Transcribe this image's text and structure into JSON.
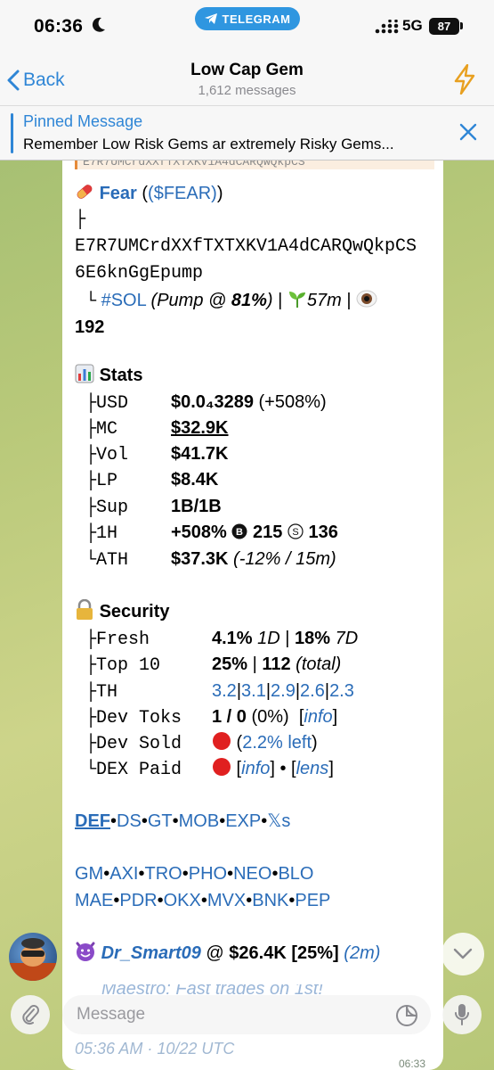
{
  "status_bar": {
    "time": "06:36",
    "app_pill": "TELEGRAM",
    "network": "5G",
    "battery": "87"
  },
  "header": {
    "back_label": "Back",
    "title": "Low Cap Gem",
    "subtitle": "1,612 messages"
  },
  "pinned": {
    "title": "Pinned Message",
    "text": "Remember Low Risk Gems ar extremely Risky Gems..."
  },
  "message": {
    "token_name": "Fear",
    "token_ticker": "($FEAR)",
    "tree_char": "├",
    "address_line1": "E7R7UMCrdXXfTXTXKV1A4dCARQwQkpCS",
    "address_line2": "6E6knGgEpump",
    "chain_tag": "#SOL",
    "pump_text": "(Pump @ ",
    "pump_pct": "81%",
    "pump_close": ")",
    "age": "57m",
    "watchers": "192",
    "stats_title": "Stats",
    "stats": [
      {
        "branch": "├",
        "label": "USD",
        "value": "$0.0₄3289",
        "extra": "(+508%)"
      },
      {
        "branch": "├",
        "label": "MC",
        "value": "$32.9K",
        "extra": ""
      },
      {
        "branch": "├",
        "label": "Vol",
        "value": "$41.7K",
        "extra": ""
      },
      {
        "branch": "├",
        "label": "LP",
        "value": "$8.4K",
        "extra": ""
      },
      {
        "branch": "├",
        "label": "Sup",
        "value": "1B/1B",
        "extra": ""
      },
      {
        "branch": "├",
        "label": "1H",
        "value": "+508%",
        "extra": "215",
        "extra2": "136"
      },
      {
        "branch": "└",
        "label": "ATH",
        "value": "$37.3K",
        "extra": "(-12% / 15m)"
      }
    ],
    "security_title": "Security",
    "security": {
      "fresh_label": "Fresh",
      "fresh_1": "4.1%",
      "fresh_1_unit": "1D",
      "fresh_2": "18%",
      "fresh_2_unit": "7D",
      "top10_label": "Top 10",
      "top10_pct": "25%",
      "top10_count": "112",
      "top10_note": "(total)",
      "th_label": "TH",
      "th_values": [
        "3.2",
        "3.1",
        "2.9",
        "2.6",
        "2.3"
      ],
      "devtoks_label": "Dev Toks",
      "devtoks_value": "1 / 0",
      "devtoks_pct": "(0%)",
      "devtoks_link": "info",
      "devsold_label": "Dev Sold",
      "devsold_value": "2.2% left",
      "dexpaid_label": "DEX Paid",
      "dexpaid_link1": "info",
      "dexpaid_link2": "lens"
    },
    "links_row1": [
      "DEF",
      "DS",
      "GT",
      "MOB",
      "EXP",
      "𝕏s"
    ],
    "links_row2": [
      "GM",
      "AXI",
      "TRO",
      "PHO",
      "NEO",
      "BLO"
    ],
    "links_row3": [
      "MAE",
      "PDR",
      "OKX",
      "MVX",
      "BNK",
      "PEP"
    ],
    "caller_name": "Dr_Smart09",
    "caller_at": "@",
    "caller_mc": "$26.4K",
    "caller_pct": "[25%]",
    "caller_age": "(2m)",
    "cut_promo": "Maestro: Fast trades on 1st!",
    "timestamp": "05:36 AM · 10/22 UTC",
    "msg_time": "06:33"
  },
  "input": {
    "placeholder": "Message"
  },
  "colors": {
    "accent": "#2f86d6",
    "link": "#2a6cb8",
    "telegram_pill": "#2f96e0"
  }
}
